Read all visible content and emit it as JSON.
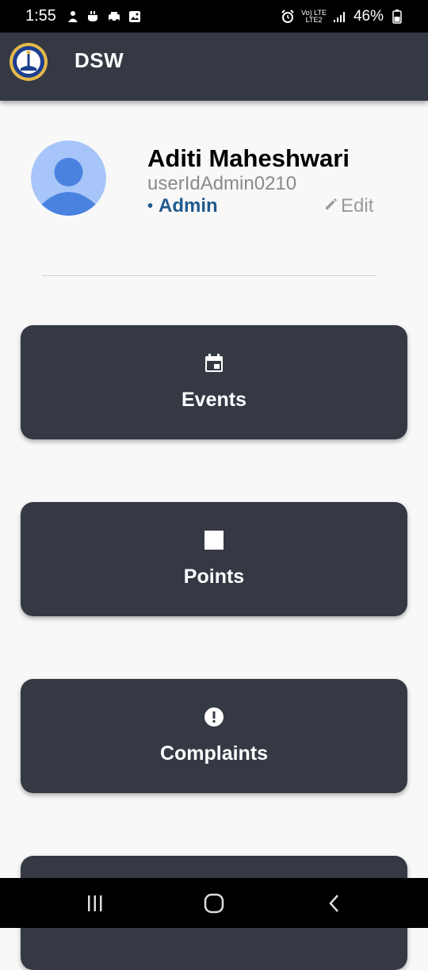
{
  "status_bar": {
    "time": "1:55",
    "network_text_top": "Vo) LTE",
    "network_text_bottom": "LTE2",
    "battery": "46%"
  },
  "app_bar": {
    "title": "DSW",
    "logo_icon": "university-seal-logo"
  },
  "profile": {
    "name": "Aditi Maheshwari",
    "user_id": "userIdAdmin0210",
    "role_bullet": "•",
    "role": "Admin",
    "edit_label": "Edit",
    "avatar_icon": "person-avatar-icon"
  },
  "menu": [
    {
      "label": "Events",
      "icon": "calendar-icon"
    },
    {
      "label": "Points",
      "icon": "square-icon"
    },
    {
      "label": "Complaints",
      "icon": "alert-circle-icon"
    }
  ],
  "colors": {
    "app_bar": "#343944",
    "card": "#343944",
    "background": "#f8f8f8",
    "role": "#1f5a8e"
  }
}
